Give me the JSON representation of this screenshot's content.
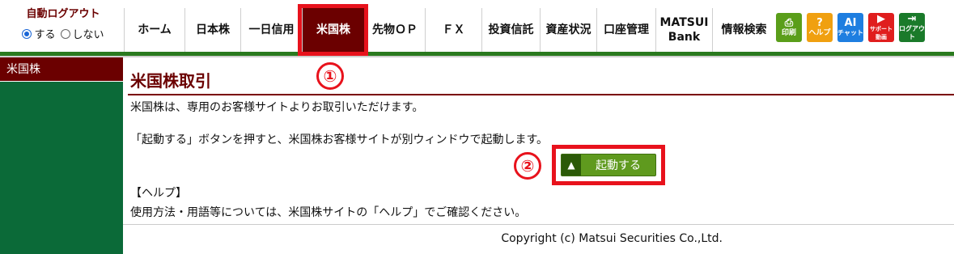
{
  "auto_logout": {
    "title": "自動ログアウト",
    "on_label": "する",
    "off_label": "しない",
    "selected": "する"
  },
  "nav": [
    {
      "label": "ホーム"
    },
    {
      "label": "日本株"
    },
    {
      "label": "一日信用"
    },
    {
      "label": "米国株",
      "active": true
    },
    {
      "label": "先物ＯＰ"
    },
    {
      "label": "ＦＸ"
    },
    {
      "label": "投資信託"
    },
    {
      "label": "資産状況"
    },
    {
      "label": "口座管理"
    },
    {
      "label_line1": "MATSUI",
      "label_line2": "Bank"
    },
    {
      "label": "情報検索"
    }
  ],
  "tools": [
    {
      "label": "印刷",
      "icon": "print-icon",
      "color": "#5a9e1a"
    },
    {
      "label": "ヘルプ",
      "icon": "help-icon",
      "color": "#f0a010"
    },
    {
      "label": "チャット",
      "icon": "ai-chat-icon",
      "glyph": "AI",
      "color": "#1e7ee0"
    },
    {
      "label": "サポート動画",
      "icon": "video-icon",
      "color": "#e01e1e"
    },
    {
      "label": "ログアウト",
      "icon": "logout-icon",
      "color": "#1a7a2a"
    }
  ],
  "sidebar": {
    "items": [
      {
        "label": "米国株"
      }
    ]
  },
  "main": {
    "title": "米国株取引",
    "intro": "米国株は、専用のお客様サイトよりお取引いただけます。",
    "instruction": "「起動する」ボタンを押すと、米国株お客様サイトが別ウィンドウで起動します。",
    "launch_label": "起動する",
    "help_heading": "【ヘルプ】",
    "help_text": "使用方法・用語等については、米国株サイトの「ヘルプ」でご確認ください。"
  },
  "annotations": {
    "marker1": "①",
    "marker2": "②"
  },
  "footer": {
    "copyright": "Copyright (c) Matsui Securities Co.,Ltd."
  },
  "colors": {
    "brand_dark_red": "#6b0000",
    "brand_green": "#0b6a38",
    "highlight_red": "#e8121c",
    "button_green": "#5f9a1e"
  }
}
